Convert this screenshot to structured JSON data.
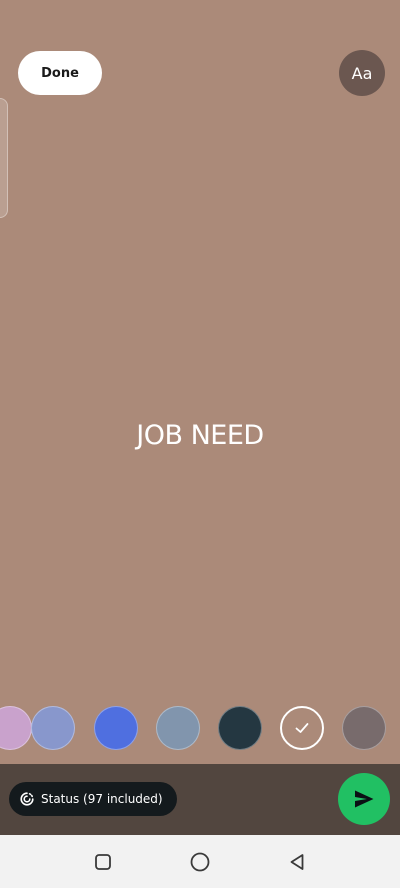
{
  "colors": {
    "canvas_bg": "#ab8a79",
    "font_button_bg": "#6b5750",
    "bottom_bar_bg": "#52463f",
    "send_green": "#21c063"
  },
  "toolbar": {
    "done_label": "Done",
    "font_label": "Aa"
  },
  "status": {
    "text": "JOB NEED"
  },
  "palette": {
    "swatches": [
      {
        "color": "#c9a2cc",
        "selected": false
      },
      {
        "color": "#8897cc",
        "selected": false
      },
      {
        "color": "#4f6fe0",
        "selected": false
      },
      {
        "color": "#8195ad",
        "selected": false
      },
      {
        "color": "#243741",
        "selected": false
      },
      {
        "color": "#ab8a79",
        "selected": true
      },
      {
        "color": "#786b6c",
        "selected": false
      }
    ]
  },
  "audience": {
    "label": "Status (97 included)"
  },
  "icons": {
    "audience": "status-ring-icon",
    "send": "send-arrow-icon",
    "check": "checkmark-icon",
    "nav_recents": "square-icon",
    "nav_home": "circle-icon",
    "nav_back": "triangle-back-icon"
  }
}
